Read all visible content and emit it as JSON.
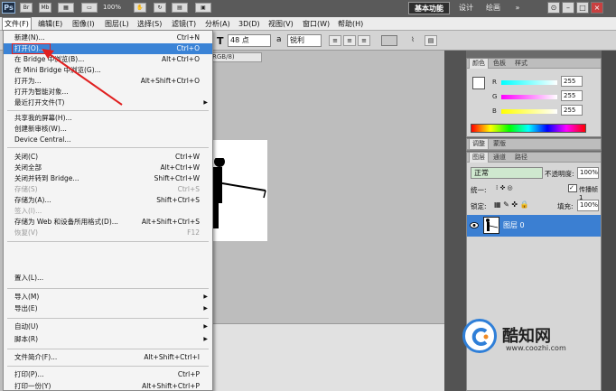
{
  "appbar": {
    "logo": "Ps",
    "zoom": "100%",
    "workspaces": [
      "基本功能",
      "设计",
      "绘画"
    ],
    "more": "»"
  },
  "menubar": {
    "items": [
      "文件(F)",
      "编辑(E)",
      "图像(I)",
      "图层(L)",
      "选择(S)",
      "滤镜(T)",
      "分析(A)",
      "3D(D)",
      "视图(V)",
      "窗口(W)",
      "帮助(H)"
    ]
  },
  "optbar": {
    "font_size": "48 点",
    "antialias": "锐利"
  },
  "document": {
    "tab_label": "RGB/8)"
  },
  "file_menu": {
    "items": [
      {
        "label": "新建(N)...",
        "shortcut": "Ctrl+N"
      },
      {
        "label": "打开(O)...",
        "shortcut": "Ctrl+O"
      },
      {
        "label": "在 Bridge 中浏览(B)...",
        "shortcut": "Alt+Ctrl+O"
      },
      {
        "label": "在 Mini Bridge 中浏览(G)...",
        "shortcut": ""
      },
      {
        "label": "打开为...",
        "shortcut": "Alt+Shift+Ctrl+O"
      },
      {
        "label": "打开为智能对象...",
        "shortcut": ""
      },
      {
        "label": "最近打开文件(T)",
        "shortcut": ""
      },
      {
        "label": "共享我的屏幕(H)...",
        "shortcut": ""
      },
      {
        "label": "创建新审核(W)...",
        "shortcut": ""
      },
      {
        "label": "Device Central...",
        "shortcut": ""
      },
      {
        "label": "关闭(C)",
        "shortcut": "Ctrl+W"
      },
      {
        "label": "关闭全部",
        "shortcut": "Alt+Ctrl+W"
      },
      {
        "label": "关闭并转到 Bridge...",
        "shortcut": "Shift+Ctrl+W"
      },
      {
        "label": "存储(S)",
        "shortcut": "Ctrl+S"
      },
      {
        "label": "存储为(A)...",
        "shortcut": "Shift+Ctrl+S"
      },
      {
        "label": "签入(I)...",
        "shortcut": ""
      },
      {
        "label": "存储为 Web 和设备所用格式(D)...",
        "shortcut": "Alt+Shift+Ctrl+S"
      },
      {
        "label": "恢复(V)",
        "shortcut": "F12"
      },
      {
        "label": "置入(L)...",
        "shortcut": ""
      },
      {
        "label": "导入(M)",
        "shortcut": ""
      },
      {
        "label": "导出(E)",
        "shortcut": ""
      },
      {
        "label": "自动(U)",
        "shortcut": ""
      },
      {
        "label": "脚本(R)",
        "shortcut": ""
      },
      {
        "label": "文件简介(F)...",
        "shortcut": "Alt+Shift+Ctrl+I"
      },
      {
        "label": "打印(P)...",
        "shortcut": "Ctrl+P"
      },
      {
        "label": "打印一份(Y)",
        "shortcut": "Alt+Shift+Ctrl+P"
      }
    ]
  },
  "color_panel": {
    "tabs": [
      "颜色",
      "色板",
      "样式"
    ],
    "r_label": "R",
    "r_value": "255",
    "g_label": "G",
    "g_value": "255",
    "b_label": "B",
    "b_value": "255"
  },
  "adjust_panel": {
    "tabs": [
      "调整",
      "蒙版"
    ]
  },
  "layers_panel": {
    "tabs": [
      "图层",
      "通道",
      "路径"
    ],
    "blend_mode": "正常",
    "opacity_label": "不透明度:",
    "opacity_value": "100%",
    "unify_label": "统一:",
    "propagate_label": "传播帧 1",
    "lock_label": "锁定:",
    "fill_label": "填充:",
    "fill_value": "100%",
    "layer_name": "图层 0"
  },
  "watermark": {
    "name": "酷知网",
    "url": "www.coozhi.com"
  },
  "colors": {
    "highlight": "#3a83d6",
    "annotation": "#e02020",
    "layer_selected": "#3b7fd2"
  }
}
